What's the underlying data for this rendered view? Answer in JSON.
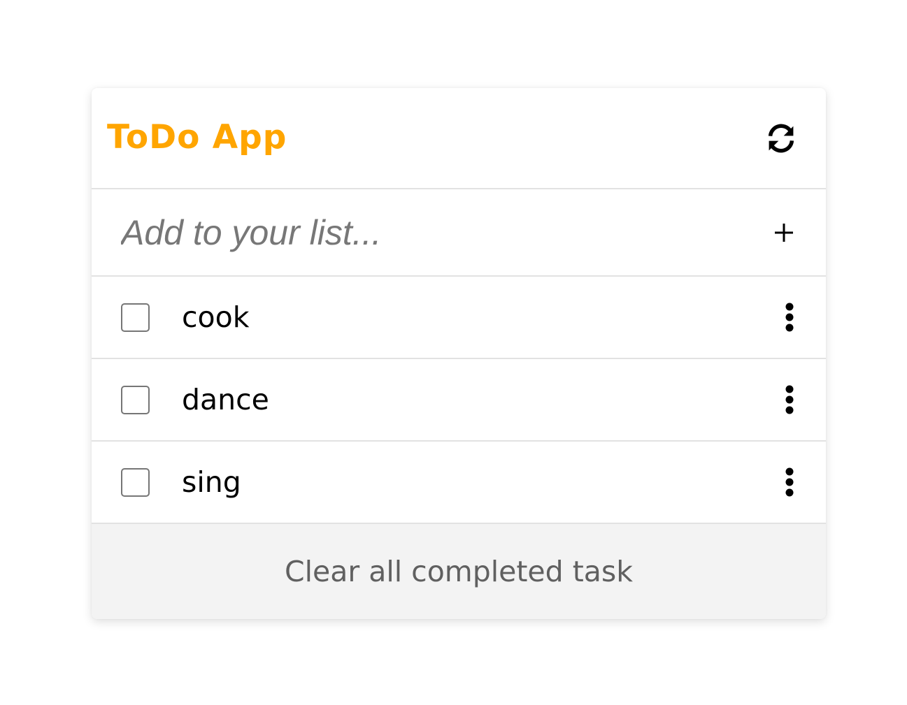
{
  "app": {
    "title": "ToDo App",
    "accent_color": "#FFA500",
    "refresh_icon": "refresh-icon"
  },
  "new_task": {
    "placeholder": "Add to your list...",
    "value": "",
    "add_icon": "plus-icon"
  },
  "tasks": [
    {
      "label": "cook",
      "completed": false,
      "menu_icon": "kebab-menu-icon"
    },
    {
      "label": "dance",
      "completed": false,
      "menu_icon": "kebab-menu-icon"
    },
    {
      "label": "sing",
      "completed": false,
      "menu_icon": "kebab-menu-icon"
    }
  ],
  "footer": {
    "clear_label": "Clear all completed task"
  }
}
